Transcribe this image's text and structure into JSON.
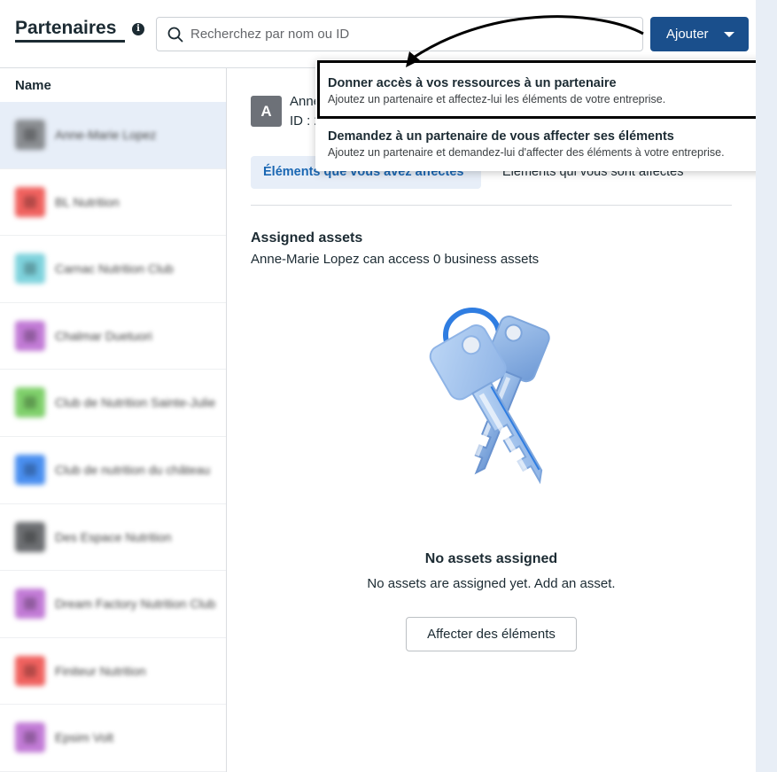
{
  "header": {
    "title": "Partenaires",
    "search_placeholder": "Recherchez par nom ou ID",
    "add_button_label": "Ajouter"
  },
  "sidebar": {
    "column_header": "Name",
    "items": [
      {
        "label": "Anne-Marie Lopez",
        "color": "#8a8d91",
        "selected": true
      },
      {
        "label": "BL Nutrition",
        "color": "#f0625f",
        "selected": false
      },
      {
        "label": "Carnac Nutrition Club",
        "color": "#7fd3dd",
        "selected": false
      },
      {
        "label": "Chalmar Duetuori",
        "color": "#c27bd6",
        "selected": false
      },
      {
        "label": "Club de Nutrition Sainte-Julie",
        "color": "#7fd06b",
        "selected": false
      },
      {
        "label": "Club de nutrition du château",
        "color": "#4a8ff0",
        "selected": false
      },
      {
        "label": "Des Espace Nutrition",
        "color": "#6d6f72",
        "selected": false
      },
      {
        "label": "Dream Factory Nutrition Club",
        "color": "#c27bd6",
        "selected": false
      },
      {
        "label": "Finiteur Nutrition",
        "color": "#f0625f",
        "selected": false
      },
      {
        "label": "Epsim Volt",
        "color": "#c27bd6",
        "selected": false
      }
    ]
  },
  "partner": {
    "avatar_letter": "A",
    "name": "Anne",
    "id_line": "ID : 2"
  },
  "tabs": {
    "active": "Éléments que vous avez affectés",
    "inactive": "Éléments qui vous sont affectés"
  },
  "assigned": {
    "title": "Assigned assets",
    "subtitle": "Anne-Marie Lopez can access 0 business assets",
    "empty_title": "No assets assigned",
    "empty_subtitle": "No assets are assigned yet. Add an asset.",
    "button_label": "Affecter des éléments",
    "illustration": "keys-icon"
  },
  "dropdown": {
    "items": [
      {
        "title": "Donner accès à vos ressources à un partenaire",
        "description": "Ajoutez un partenaire et affectez-lui les éléments de votre entreprise."
      },
      {
        "title": "Demandez à un partenaire de vous affecter ses éléments",
        "description": "Ajoutez un partenaire et demandez-lui d'affecter des éléments à votre entreprise."
      }
    ]
  },
  "colors": {
    "primary_button": "#1a4f8c",
    "active_tab_bg": "#e7eef8",
    "active_tab_text": "#1a67b3"
  }
}
